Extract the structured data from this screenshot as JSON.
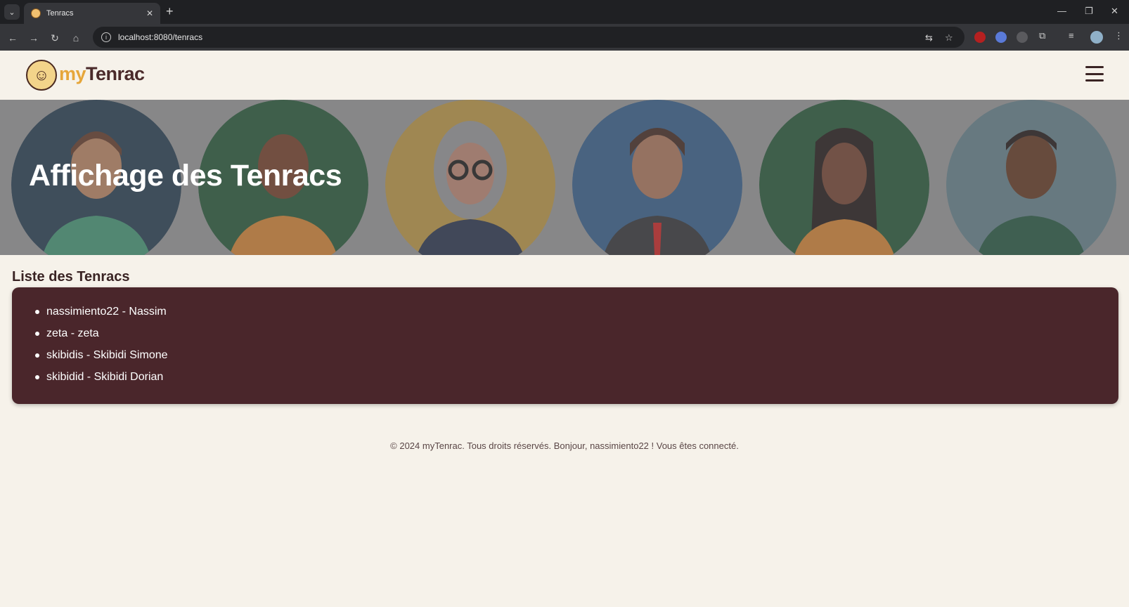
{
  "browser": {
    "tab_title": "Tenracs",
    "tab_close": "✕",
    "new_tab": "+",
    "url": "localhost:8080/tenracs"
  },
  "header": {
    "logo_my": "my",
    "logo_tenrac": "Tenrac"
  },
  "hero": {
    "title": "Affichage des Tenracs",
    "avatar_colors": [
      "#1d3348",
      "#1d4e2e",
      "#8a6a2a",
      "#2c5480",
      "#1d4e2e",
      "#5a7680"
    ]
  },
  "main": {
    "section_title": "Liste des Tenracs",
    "tenracs": [
      "nassimiento22 - Nassim",
      "zeta - zeta",
      "skibidis - Skibidi Simone",
      "skibidid - Skibidi Dorian"
    ]
  },
  "footer": {
    "text": "© 2024 myTenrac. Tous droits réservés. Bonjour, nassimiento22 ! Vous êtes connecté."
  },
  "colors": {
    "accent": "#e6a63a",
    "panel": "#4a262b",
    "background": "#f6f2ea"
  }
}
